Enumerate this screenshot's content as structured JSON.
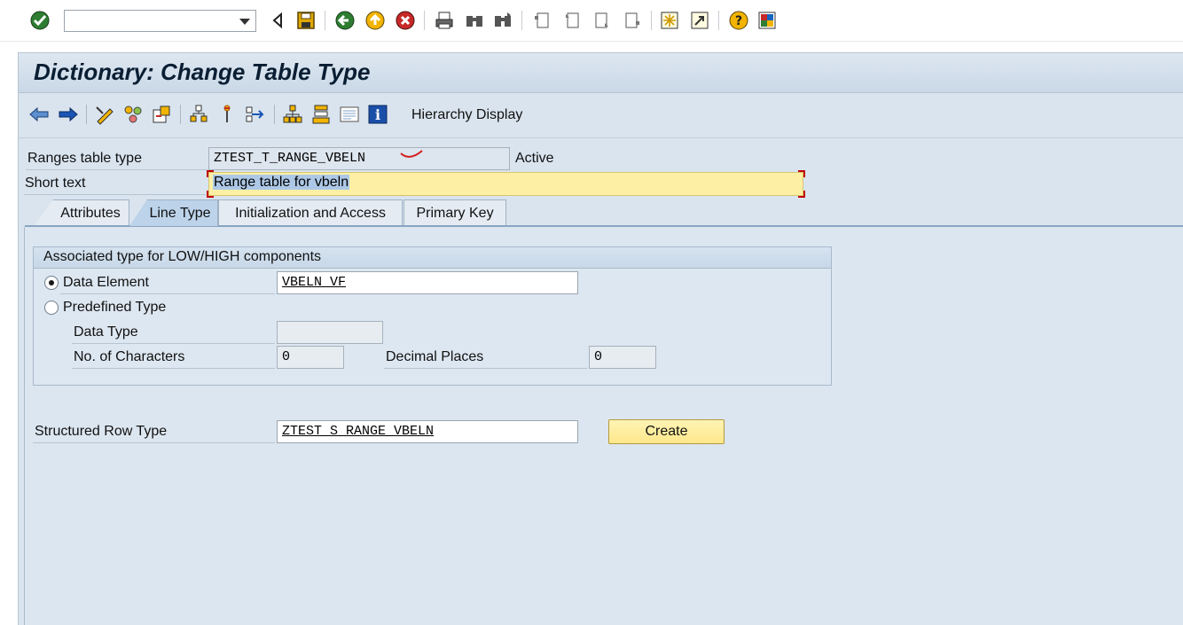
{
  "system_toolbar": {
    "command_field": {
      "value": "",
      "placeholder": ""
    },
    "icons": [
      "enter-icon",
      "back-triangle-icon",
      "save-icon",
      "back-icon",
      "exit-icon",
      "cancel-icon",
      "print-icon",
      "find-icon",
      "find-next-icon",
      "first-page-icon",
      "previous-page-icon",
      "next-page-icon",
      "last-page-icon",
      "new-session-icon",
      "create-shortcut-icon",
      "help-icon",
      "customize-layout-icon"
    ]
  },
  "window": {
    "title": "Dictionary: Change Table Type"
  },
  "app_toolbar": {
    "icons": [
      "back-arrow-icon",
      "forward-arrow-icon",
      "display-change-icon",
      "other-object-icon",
      "activate-icon",
      "where-used-icon",
      "object-list-icon",
      "navigation-window-icon",
      "display-object-list-icon",
      "hierarchy-icon",
      "stack-icon",
      "documentation-icon",
      "info-icon"
    ],
    "hierarchy_display_label": "Hierarchy Display"
  },
  "header": {
    "ranges_label": "Ranges table type",
    "ranges_value": "ZTEST_T_RANGE_VBELN",
    "status": "Active",
    "short_text_label": "Short text",
    "short_text_value": "Range table for vbeln"
  },
  "tabs": [
    {
      "label": "Attributes",
      "active": false
    },
    {
      "label": "Line Type",
      "active": true
    },
    {
      "label": "Initialization and Access",
      "active": false
    },
    {
      "label": "Primary Key",
      "active": false
    }
  ],
  "line_type": {
    "group_title": "Associated type for LOW/HIGH components",
    "data_element_label": "Data Element",
    "data_element_selected": true,
    "data_element_value": "VBELN_VF",
    "predefined_type_label": "Predefined Type",
    "data_type_label": "Data Type",
    "data_type_value": "",
    "no_characters_label": "No. of Characters",
    "no_characters_value": "0",
    "decimal_places_label": "Decimal Places",
    "decimal_places_value": "0",
    "structured_row_type_label": "Structured Row Type",
    "structured_row_type_value": "ZTEST_S_RANGE_VBELN",
    "create_button": "Create"
  }
}
